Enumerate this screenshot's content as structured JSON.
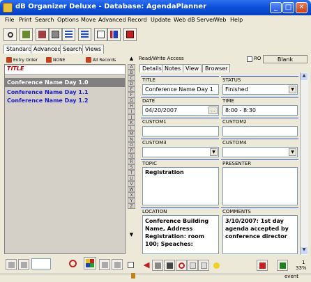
{
  "window": {
    "title": "dB Organizer Deluxe - Database: AgendaPlanner"
  },
  "menu": [
    "File",
    "Print",
    "Search",
    "Options",
    "Move",
    "Advanced",
    "Record",
    "Update",
    "Web dB Server",
    "Web",
    "Help"
  ],
  "view_tabs": [
    "Standard",
    "Advanced",
    "Search",
    "Views"
  ],
  "left": {
    "sort_buttons": [
      "Entry Order",
      "NONE",
      "All Records"
    ],
    "column_header": "TITLE",
    "rows": [
      "Conference Name Day 1.0",
      "Conference Name Day 1.1",
      "Conference Name Day 1.2"
    ],
    "selected_index": 0
  },
  "alphabet": [
    "A",
    "B",
    "C",
    "D",
    "E",
    "F",
    "G",
    "H",
    "I",
    "J",
    "K",
    "L",
    "M",
    "N",
    "O",
    "P",
    "Q",
    "R",
    "S",
    "T",
    "U",
    "V",
    "W",
    "X",
    "Y",
    "Z"
  ],
  "right": {
    "access": "Read/Write Access",
    "ro_label": "RO",
    "blank_label": "Blank",
    "tabs": [
      "Details",
      "Notes",
      "View",
      "Browser"
    ],
    "active_tab": "Details"
  },
  "fields": {
    "title": {
      "label": "TITLE",
      "value": "Conference Name Day 1"
    },
    "status": {
      "label": "STATUS",
      "value": "Finished"
    },
    "date": {
      "label": "DATE",
      "value": "04/20/2007",
      "button": "..."
    },
    "time": {
      "label": "TIME",
      "value": "8:00 - 8:30"
    },
    "custom1": {
      "label": "CUSTOM1",
      "value": ""
    },
    "custom2": {
      "label": "CUSTOM2",
      "value": ""
    },
    "custom3": {
      "label": "CUSTOM3",
      "value": ""
    },
    "custom4": {
      "label": "CUSTOM4",
      "value": ""
    },
    "topic": {
      "label": "TOPIC",
      "value": "Registration"
    },
    "presenter": {
      "label": "PRESENTER",
      "value": ""
    },
    "location": {
      "label": "LOCATION",
      "value": "Conference Building Name, Address Registration: room 100; Speaches:"
    },
    "comments": {
      "label": "COMMENTS",
      "value": "3/10/2007: 1st day agenda accepted by conference director"
    }
  },
  "status": {
    "record": "1",
    "percent": "33%",
    "mode": "event"
  },
  "colors": {
    "title_bar": "#0a4fd8",
    "selected_row": "#808080",
    "row_text": "#1a1ad0",
    "header_text": "#c00000",
    "section_line": "#2a4fc8"
  }
}
